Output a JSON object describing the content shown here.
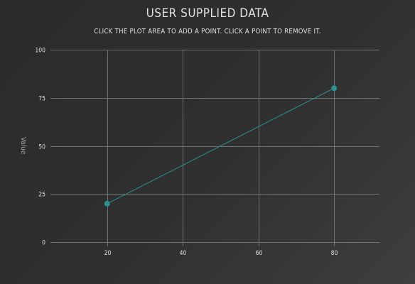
{
  "chart_data": {
    "type": "line",
    "title": "USER SUPPLIED DATA",
    "subtitle": "CLICK THE PLOT AREA TO ADD A POINT. CLICK A POINT TO REMOVE IT.",
    "xlabel": "",
    "ylabel": "Value",
    "xlim": [
      5,
      92
    ],
    "ylim": [
      0,
      100
    ],
    "x_ticks": [
      20,
      40,
      60,
      80
    ],
    "y_ticks": [
      0,
      25,
      50,
      75,
      100
    ],
    "grid": true,
    "legend": "none",
    "series": [
      {
        "x": [
          20,
          80
        ],
        "values": [
          20,
          80
        ],
        "color": "#2b908f"
      }
    ]
  }
}
